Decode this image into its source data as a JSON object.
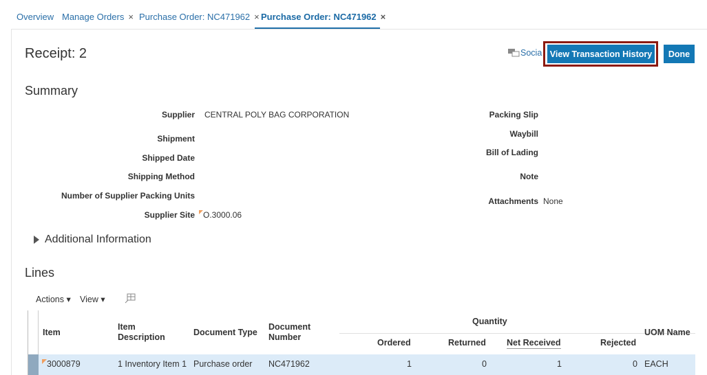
{
  "tabs": [
    {
      "label": "Overview",
      "closable": false
    },
    {
      "label": "Manage Orders",
      "closable": true
    },
    {
      "label": "Purchase Order: NC471962",
      "closable": true
    },
    {
      "label": "Purchase Order: NC471962",
      "closable": true,
      "active": true
    }
  ],
  "close_glyph": "×",
  "header": {
    "title": "Receipt: 2",
    "social_label": "Socia",
    "view_history_label": "View Transaction History",
    "done_label": "Done"
  },
  "summary": {
    "title": "Summary",
    "left": [
      {
        "label": "Supplier",
        "value": "CENTRAL POLY BAG CORPORATION"
      },
      {
        "label": "Shipment",
        "value": ""
      },
      {
        "label": "Shipped Date",
        "value": ""
      },
      {
        "label": "Shipping Method",
        "value": ""
      },
      {
        "label": "Number of Supplier Packing Units",
        "value": ""
      },
      {
        "label": "Supplier Site",
        "value": "O.3000.06"
      }
    ],
    "right": [
      {
        "label": "Packing Slip",
        "value": ""
      },
      {
        "label": "Waybill",
        "value": ""
      },
      {
        "label": "Bill of Lading",
        "value": ""
      },
      {
        "label": "Note",
        "value": ""
      },
      {
        "label": "Attachments",
        "value": "None"
      }
    ]
  },
  "additional_info": "Additional Information",
  "lines": {
    "title": "Lines",
    "actions_label": "Actions",
    "view_label": "View",
    "columns": {
      "item": "Item",
      "item_desc_1": "Item",
      "item_desc_2": "Description",
      "doc_type": "Document Type",
      "doc_num_1": "Document",
      "doc_num_2": "Number",
      "quantity": "Quantity",
      "ordered": "Ordered",
      "returned": "Returned",
      "net_received": "Net Received",
      "rejected": "Rejected",
      "uom": "UOM Name"
    },
    "rows": [
      {
        "item": "3000879",
        "description": "1 Inventory Item 1",
        "doc_type": "Purchase order",
        "doc_number": "NC471962",
        "ordered": "1",
        "returned": "0",
        "net_received": "1",
        "rejected": "0",
        "uom": "EACH"
      }
    ]
  },
  "colors": {
    "accent": "#1378b5",
    "highlight": "#8b1a10",
    "row_selected": "#dcebf8"
  }
}
